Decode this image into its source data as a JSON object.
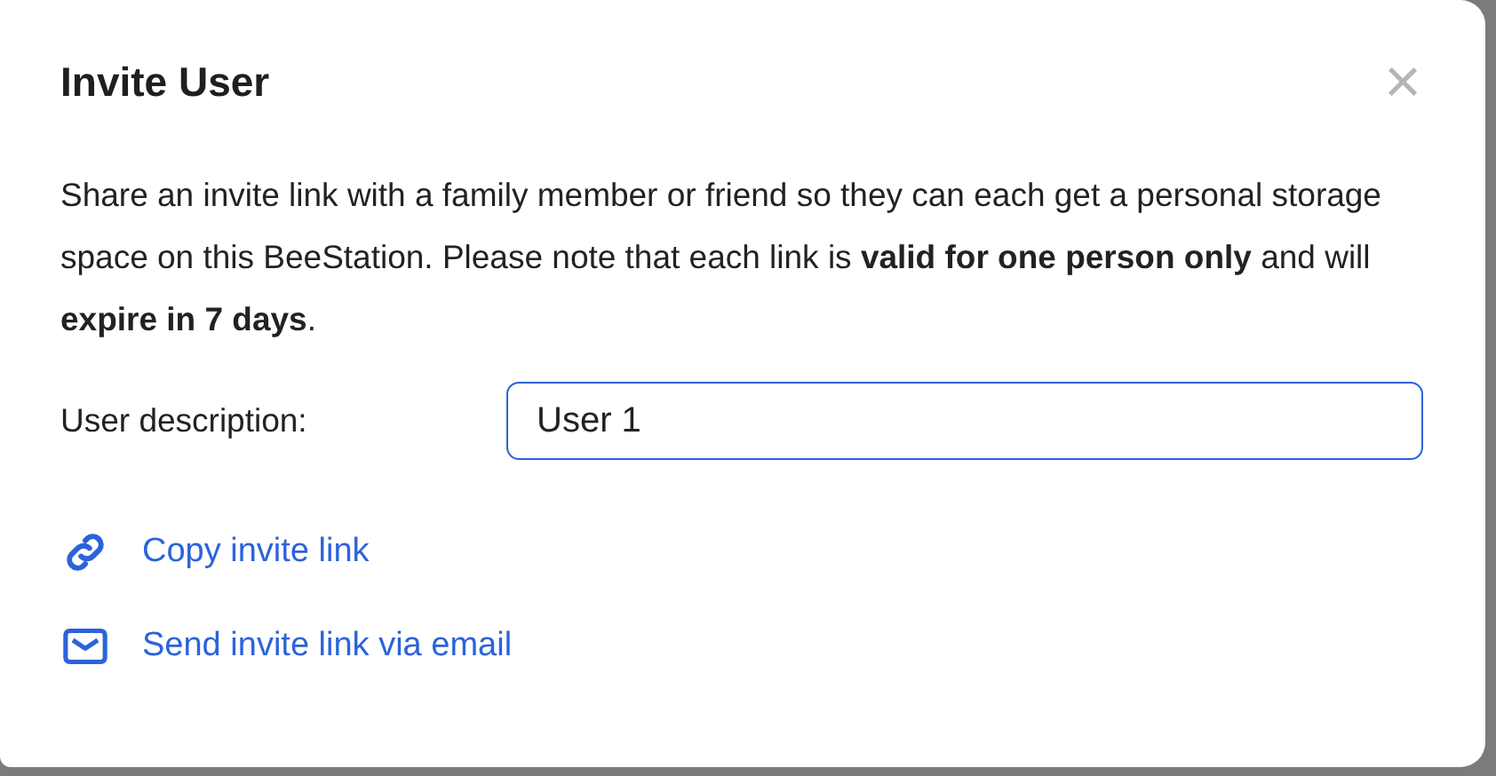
{
  "dialog": {
    "title": "Invite User",
    "close": "×",
    "description": "Share an invite link with a family member or friend so they can each get a personal storage space on this BeeStation. Please note that each link is **valid for one person only** and will **expire in 7 days**.",
    "field": {
      "label": "User description:",
      "value": "User 1",
      "focused": true
    },
    "actions": [
      {
        "kind": "link",
        "label": "Copy invite link"
      },
      {
        "kind": "email",
        "label": "Send invite link via email"
      }
    ]
  }
}
